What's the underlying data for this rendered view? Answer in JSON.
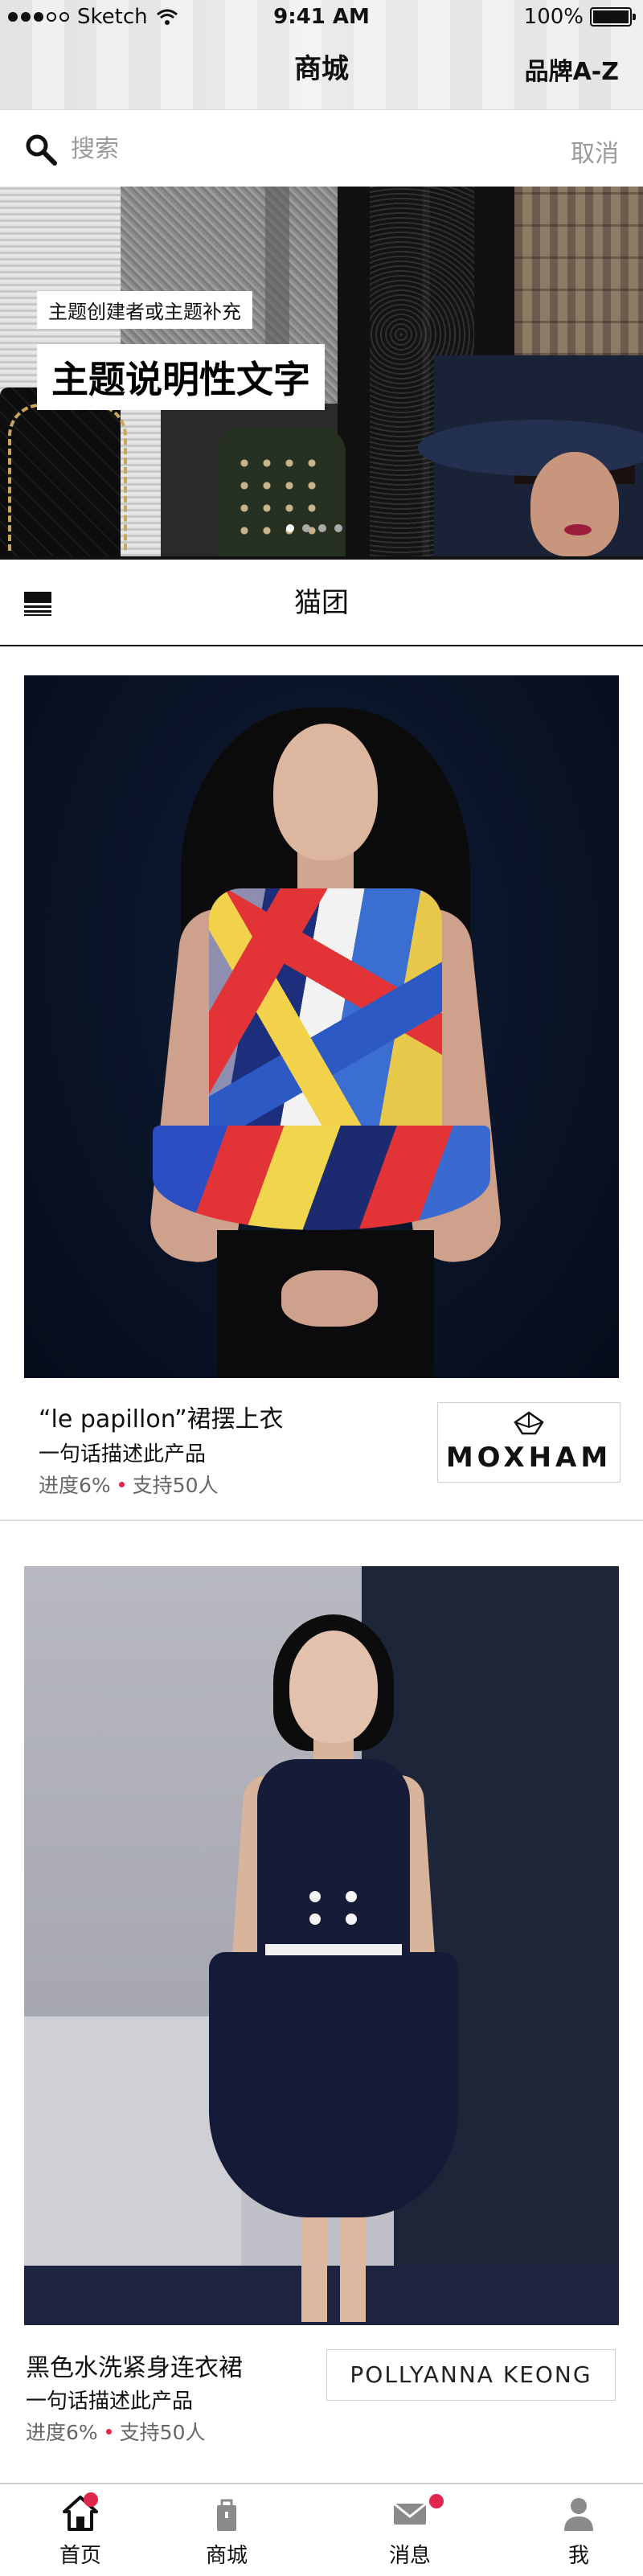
{
  "status_bar": {
    "carrier": "Sketch",
    "time": "9:41 AM",
    "battery": "100%"
  },
  "nav": {
    "title": "商城",
    "right_link": "品牌A-Z"
  },
  "search": {
    "placeholder": "搜索",
    "cancel_label": "取消"
  },
  "banner": {
    "subtitle": "主题创建者或主题补充",
    "headline": "主题说明性文字",
    "page_count": 4,
    "active_page": 1
  },
  "section": {
    "title": "猫团"
  },
  "products": [
    {
      "name": "“le papillon”裙摆上衣",
      "description": "一句话描述此产品",
      "progress_label": "进度6%",
      "supporters_label": "支持50人",
      "brand": "MOXHAM"
    },
    {
      "name": "黑色水洗紧身连衣裙",
      "description": "一句话描述此产品",
      "progress_label": "进度6%",
      "supporters_label": "支持50人",
      "brand": "POLLYANNA KEONG"
    }
  ],
  "tab_bar": {
    "items": [
      {
        "label": "首页",
        "icon": "home-icon",
        "badge": true,
        "active": true
      },
      {
        "label": "商城",
        "icon": "shop-icon",
        "badge": false,
        "active": false
      },
      {
        "label": "消息",
        "icon": "mail-icon",
        "badge": true,
        "active": false
      },
      {
        "label": "我",
        "icon": "person-icon",
        "badge": false,
        "active": false
      }
    ]
  },
  "colors": {
    "accent_badge": "#e0264b",
    "text_primary": "#111111",
    "text_secondary": "#9a9a9a"
  }
}
